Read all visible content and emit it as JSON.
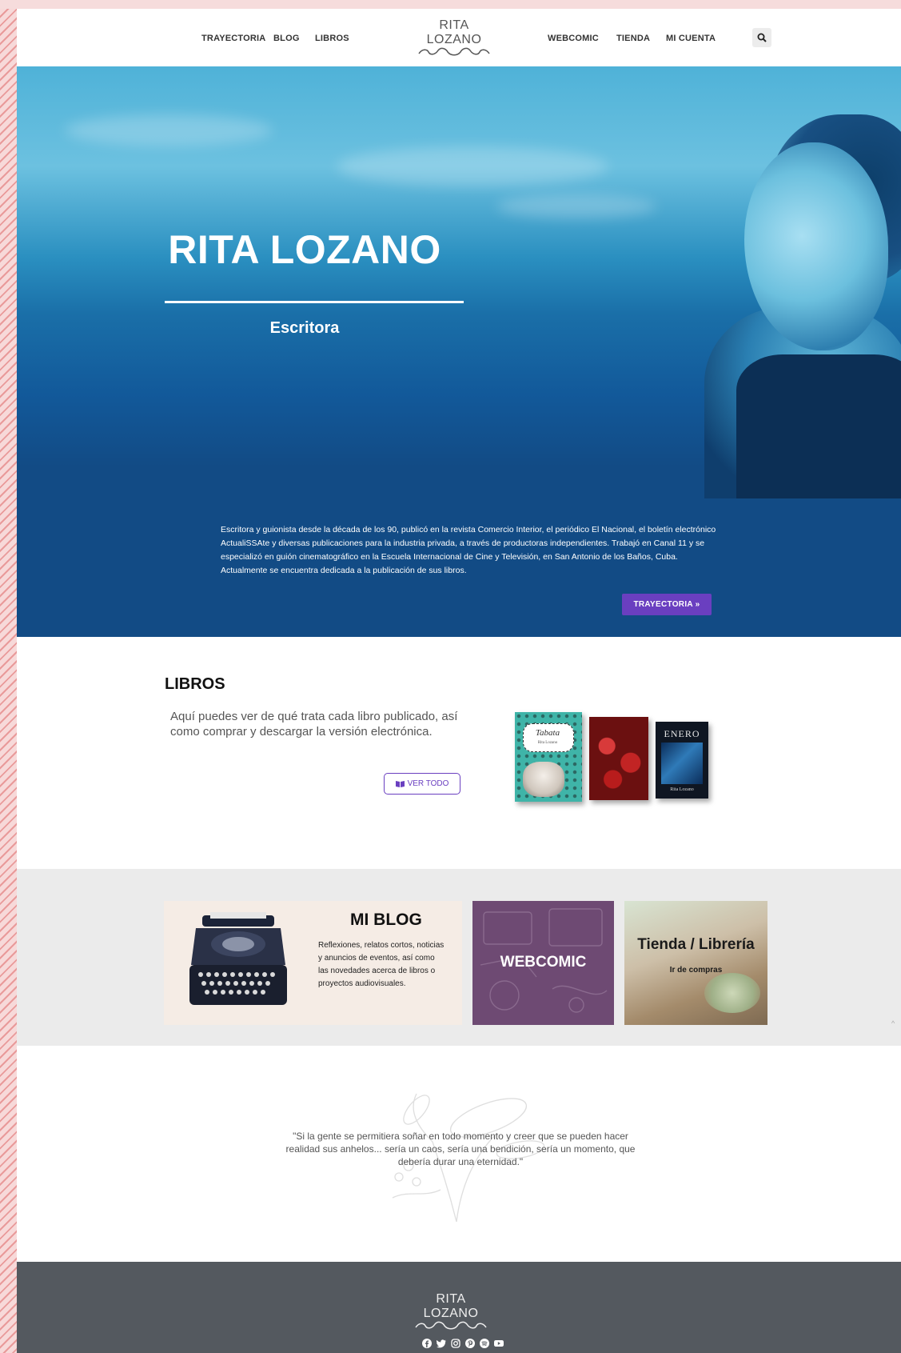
{
  "header": {
    "nav_left": [
      "TRAYECTORIA",
      "BLOG",
      "LIBROS"
    ],
    "nav_right": [
      "WEBCOMIC",
      "TIENDA",
      "MI CUENTA"
    ],
    "logo_text": "RITA LOZANO"
  },
  "hero": {
    "title": "RITA LOZANO",
    "subtitle": "Escritora",
    "bio": "Escritora y guionista desde la década de los 90, publicó en la revista Comercio Interior, el periódico El Nacional, el boletín electrónico ActualiSSAte y diversas publicaciones para la industria privada, a través de productoras independientes. Trabajó en Canal 11 y se especializó en guión cinematográfico en la Escuela Internacional de Cine y Televisión, en San Antonio de los Baños, Cuba. Actualmente se encuentra dedicada a la publicación de sus libros.",
    "button_label": "TRAYECTORIA »"
  },
  "libros": {
    "heading": "LIBROS",
    "text": "Aquí puedes ver de qué trata cada libro publicado, así como comprar y descargar la versión electrónica.",
    "button_label": "VER TODO",
    "book1_title": "Tabata",
    "book1_author": "Rita Lozano",
    "book3_title": "ENERO",
    "book3_author": "Rita Lozano"
  },
  "cards": {
    "blog_title": "MI BLOG",
    "blog_text": "Reflexiones, relatos cortos, noticias y anuncios de eventos, así como las novedades acerca de libros o proyectos audiovisuales.",
    "webcomic_title": "WEBCOMIC",
    "shop_title": "Tienda / Librería",
    "shop_link": "Ir de compras"
  },
  "quote": {
    "text": "\"Si la gente se permitiera soñar en todo momento y creer que se pueden hacer realidad sus anhelos... sería un caos, sería una bendición, sería un momento, que debería durar una eternidad.\""
  },
  "footer": {
    "logo_text": "RITA LOZANO",
    "social_icons": [
      "facebook-icon",
      "twitter-icon",
      "instagram-icon",
      "pinterest-icon",
      "spotify-icon",
      "youtube-icon"
    ]
  },
  "colors": {
    "hero_blue": "#124b85",
    "accent_purple": "#6a3fc0",
    "footer_gray": "#54595f",
    "webcomic_purple": "#6e4a73"
  }
}
